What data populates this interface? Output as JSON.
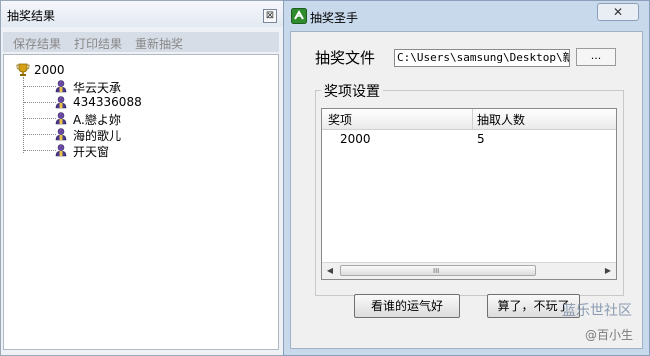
{
  "result_window": {
    "title": "抽奖结果",
    "close_label": "⊠",
    "menu": [
      "保存结果",
      "打印结果",
      "重新抽奖"
    ],
    "tree": {
      "root": "2000",
      "children": [
        "华云天承",
        "434336088",
        "A.戀よ妳",
        "海的歌儿",
        "开天窗"
      ]
    }
  },
  "main_window": {
    "title": "抽奖圣手",
    "close_label": "✕",
    "file_label": "抽奖文件",
    "file_path": "C:\\Users\\samsung\\Desktop\\新建",
    "browse_label": "...",
    "group_title": "奖项设置",
    "columns": [
      "奖项",
      "抽取人数"
    ],
    "rows": [
      {
        "prize": "2000",
        "count": "5"
      }
    ],
    "scroll_grip": "III",
    "button_start": "看谁的运气好",
    "button_quit": "算了，不玩了"
  },
  "watermark": {
    "line1": "蓝乐世社区",
    "line2": "@百小生"
  },
  "icons": {
    "root": "trophy-icon",
    "child": "person-icon",
    "app": "app-icon"
  },
  "colors": {
    "trophy": "#d4a017",
    "person": "#6b4aa6",
    "app_icon": "#2e8b2e"
  }
}
